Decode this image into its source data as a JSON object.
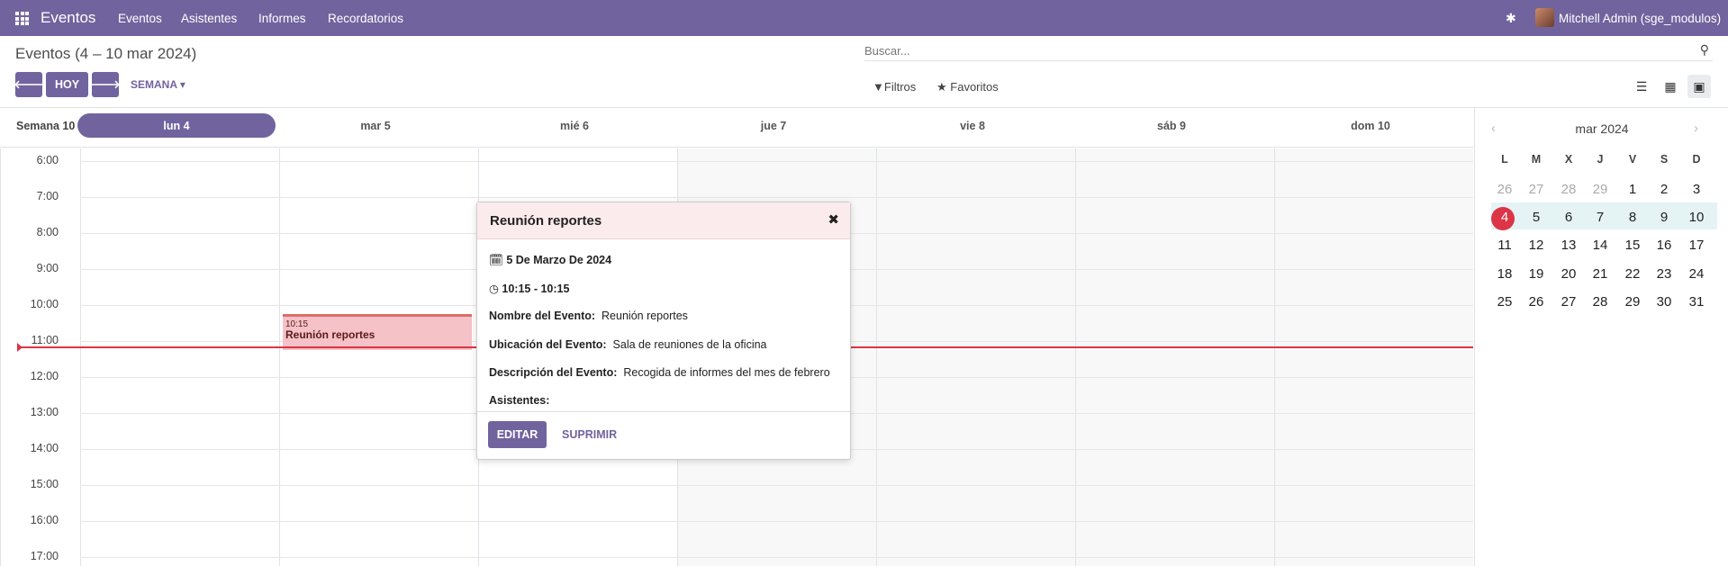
{
  "app": {
    "name": "Eventos"
  },
  "menu": [
    "Eventos",
    "Asistentes",
    "Informes",
    "Recordatorios"
  ],
  "user": {
    "name": "Mitchell Admin (sge_modulos)"
  },
  "page": {
    "title": "Eventos (4 – 10 mar 2024)"
  },
  "nav": {
    "prev_icon": "arrow-left-icon",
    "today_label": "HOY",
    "next_icon": "arrow-right-icon",
    "scale_label": "SEMANA"
  },
  "search": {
    "placeholder": "Buscar..."
  },
  "filters": {
    "filters_label": "Filtros",
    "favorites_label": "Favoritos"
  },
  "views": [
    "list-view-icon",
    "kanban-view-icon",
    "calendar-view-icon"
  ],
  "calendar": {
    "week_label": "Semana 10",
    "days": [
      "lun 4",
      "mar 5",
      "mié 6",
      "jue 7",
      "vie 8",
      "sáb 9",
      "dom 10"
    ],
    "times": [
      "6:00",
      "7:00",
      "8:00",
      "9:00",
      "10:00",
      "11:00",
      "12:00",
      "13:00",
      "14:00",
      "15:00",
      "16:00",
      "17:00"
    ]
  },
  "event": {
    "time": "10:15",
    "name": "Reunión reportes"
  },
  "popover": {
    "title": "Reunión reportes",
    "date": "5 De Marzo De 2024",
    "time": "10:15 - 10:15",
    "fields": [
      {
        "label": "Nombre del Evento:",
        "value": "Reunión reportes"
      },
      {
        "label": "Ubicación del Evento:",
        "value": "Sala de reuniones de la oficina"
      },
      {
        "label": "Descripción del Evento:",
        "value": "Recogida de informes del mes de febrero"
      },
      {
        "label": "Asistentes:",
        "value": ""
      }
    ],
    "edit_label": "EDITAR",
    "delete_label": "SUPRIMIR"
  },
  "mini_calendar": {
    "title": "mar 2024",
    "weekdays": [
      "L",
      "M",
      "X",
      "J",
      "V",
      "S",
      "D"
    ],
    "weeks": [
      [
        "26",
        "27",
        "28",
        "29",
        "1",
        "2",
        "3"
      ],
      [
        "4",
        "5",
        "6",
        "7",
        "8",
        "9",
        "10"
      ],
      [
        "11",
        "12",
        "13",
        "14",
        "15",
        "16",
        "17"
      ],
      [
        "18",
        "19",
        "20",
        "21",
        "22",
        "23",
        "24"
      ],
      [
        "25",
        "26",
        "27",
        "28",
        "29",
        "30",
        "31"
      ]
    ],
    "today": "4"
  },
  "colors": {
    "brand": "#71639e",
    "now_line": "#dc3545",
    "event_bg": "#f5c2c7"
  }
}
